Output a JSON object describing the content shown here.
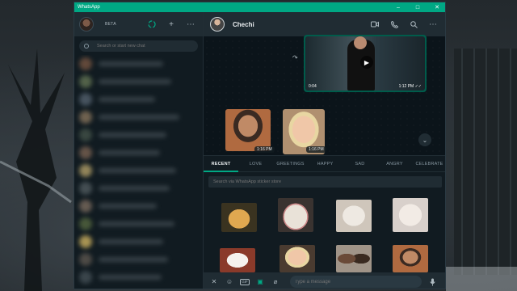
{
  "window": {
    "title": "WhatsApp",
    "minimize": "–",
    "maximize": "□",
    "close": "✕"
  },
  "left": {
    "badge": "BETA",
    "icons": {
      "status": "status-icon",
      "new_chat": "+",
      "menu": "⋯"
    },
    "search_placeholder": "Search or start new chat"
  },
  "chat": {
    "name": "Chechi",
    "icons": {
      "video": "video-call-icon",
      "call": "phone-icon",
      "search": "search-icon",
      "menu": "⋯"
    },
    "video_message": {
      "duration": "0:04",
      "time": "1:12 PM",
      "status": "✓✓"
    },
    "forward_icon": "↷",
    "stickers": [
      {
        "time": "1:16 PM"
      },
      {
        "time": "1:16 PM"
      }
    ],
    "scroll_down": "⌄"
  },
  "sticker_panel": {
    "tabs": [
      "RECENT",
      "LOVE",
      "GREETINGS",
      "HAPPY",
      "SAD",
      "ANGRY",
      "CELEBRATE"
    ],
    "active_tab": "RECENT",
    "search_placeholder": "Search via WhatsApp sticker store"
  },
  "composer": {
    "close": "✕",
    "emoji": "☺",
    "gif": "GIF",
    "sticker": "▣",
    "attach": "⌀",
    "placeholder": "Type a message",
    "mic": "🎙"
  },
  "colors": {
    "accent": "#00a884",
    "bg": "#0b141a",
    "panel": "#111b21",
    "header": "#202c33",
    "outgoing": "#005c4b"
  }
}
